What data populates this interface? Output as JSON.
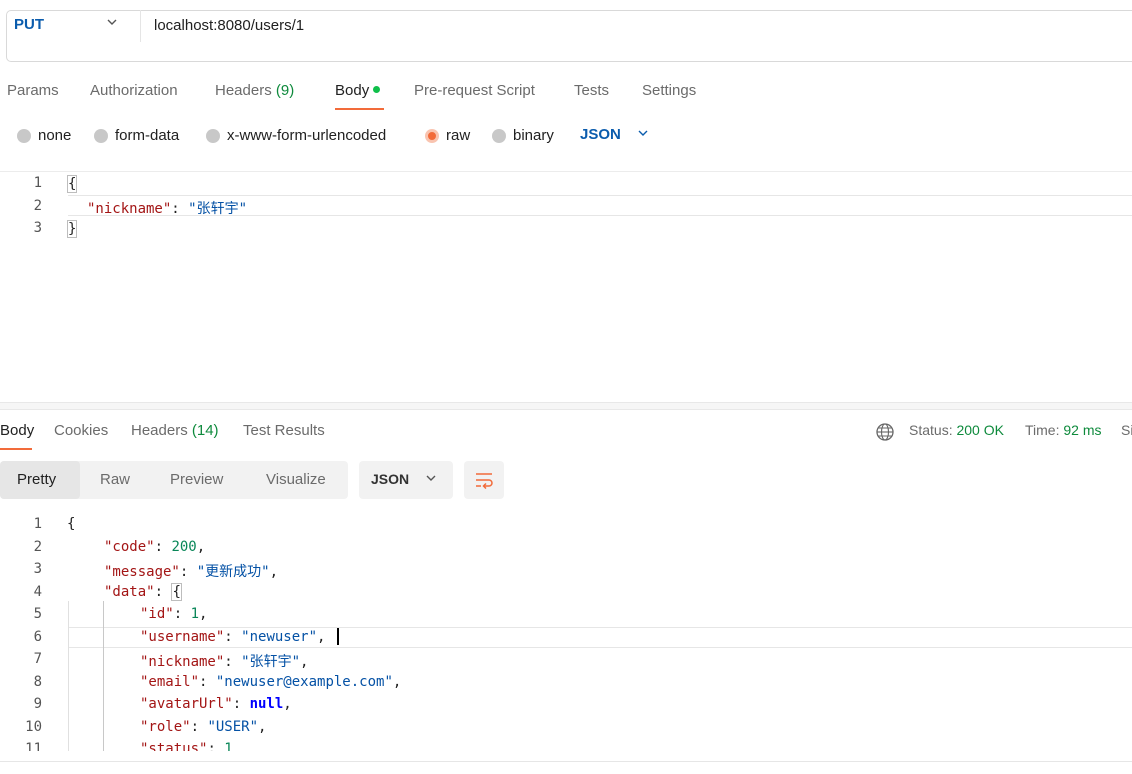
{
  "request": {
    "method": "PUT",
    "url": "localhost:8080/users/1"
  },
  "request_tabs": {
    "params": "Params",
    "authorization": "Authorization",
    "headers": "Headers",
    "headers_count": "(9)",
    "body": "Body",
    "prerequest": "Pre-request Script",
    "tests": "Tests",
    "settings": "Settings"
  },
  "body_types": {
    "none": "none",
    "form_data": "form-data",
    "urlencoded": "x-www-form-urlencoded",
    "raw": "raw",
    "binary": "binary",
    "selected": "raw",
    "format": "JSON"
  },
  "request_body": {
    "line_numbers": [
      "1",
      "2",
      "3"
    ],
    "open": "{",
    "key": "\"nickname\"",
    "colon": ": ",
    "value": "\"张轩宇\"",
    "close": "}"
  },
  "response_tabs": {
    "body": "Body",
    "cookies": "Cookies",
    "headers": "Headers",
    "headers_count": "(14)",
    "test_results": "Test Results"
  },
  "response_status": {
    "status_label": "Status:",
    "status_value": "200 OK",
    "time_label": "Time:",
    "time_value": "92 ms",
    "size_label_partial": "Si"
  },
  "response_view": {
    "pretty": "Pretty",
    "raw": "Raw",
    "preview": "Preview",
    "visualize": "Visualize",
    "format": "JSON"
  },
  "response_body": {
    "line_numbers": [
      "1",
      "2",
      "3",
      "4",
      "5",
      "6",
      "7",
      "8",
      "9",
      "10",
      "11"
    ],
    "l1": "{",
    "code_key": "\"code\"",
    "code_val": "200",
    "message_key": "\"message\"",
    "message_val": "\"更新成功\"",
    "data_key": "\"data\"",
    "data_open": "{",
    "id_key": "\"id\"",
    "id_val": "1",
    "username_key": "\"username\"",
    "username_val": "\"newuser\"",
    "nickname_key": "\"nickname\"",
    "nickname_val": "\"张轩宇\"",
    "email_key": "\"email\"",
    "email_val": "\"newuser@example.com\"",
    "avatar_key": "\"avatarUrl\"",
    "avatar_val": "null",
    "role_key": "\"role\"",
    "role_val": "\"USER\"",
    "status_key": "\"status\"",
    "status_val": "1"
  },
  "colors": {
    "accent": "#f26b3a",
    "method": "#0b5cad",
    "success": "#0e8a3c",
    "json_key": "#a31515",
    "json_string": "#0451a5",
    "json_number": "#098658"
  }
}
